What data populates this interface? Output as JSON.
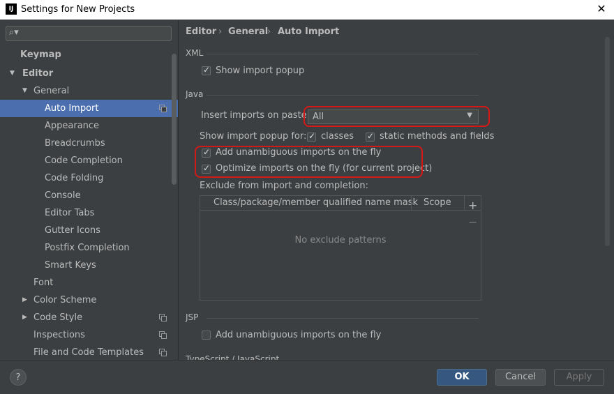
{
  "window": {
    "title": "Settings for New Projects",
    "logo_text": "IJ"
  },
  "sidebar": {
    "search": {
      "value": "",
      "placeholder": ""
    },
    "items": [
      {
        "label": "Keymap"
      },
      {
        "label": "Editor"
      },
      {
        "label": "General"
      },
      {
        "label": "Auto Import"
      },
      {
        "label": "Appearance"
      },
      {
        "label": "Breadcrumbs"
      },
      {
        "label": "Code Completion"
      },
      {
        "label": "Code Folding"
      },
      {
        "label": "Console"
      },
      {
        "label": "Editor Tabs"
      },
      {
        "label": "Gutter Icons"
      },
      {
        "label": "Postfix Completion"
      },
      {
        "label": "Smart Keys"
      },
      {
        "label": "Font"
      },
      {
        "label": "Color Scheme"
      },
      {
        "label": "Code Style"
      },
      {
        "label": "Inspections"
      },
      {
        "label": "File and Code Templates"
      }
    ]
  },
  "breadcrumb": {
    "a": "Editor",
    "b": "General",
    "c": "Auto Import",
    "sep": "›"
  },
  "xml": {
    "section": "XML",
    "show_import_popup": "Show import popup"
  },
  "java": {
    "section": "Java",
    "insert_label": "Insert imports on paste:",
    "insert_value": "All",
    "show_popup_for": "Show import popup for:",
    "classes": "classes",
    "static_methods": "static methods and fields",
    "add_unambiguous": "Add unambiguous imports on the fly",
    "optimize": "Optimize imports on the fly (for current project)",
    "exclude_label": "Exclude from import and completion:",
    "table_col1": "Class/package/member qualified name mask",
    "table_col2": "Scope",
    "table_empty": "No exclude patterns",
    "add_symbol": "+",
    "remove_symbol": "−"
  },
  "jsp": {
    "section": "JSP",
    "add_unambiguous": "Add unambiguous imports on the fly"
  },
  "ts": {
    "section": "TypeScript / JavaScript"
  },
  "buttons": {
    "help": "?",
    "ok": "OK",
    "cancel": "Cancel",
    "apply": "Apply"
  },
  "colors": {
    "accent": "#4b6eaf",
    "highlight": "#d41818",
    "background": "#3c3f41"
  }
}
